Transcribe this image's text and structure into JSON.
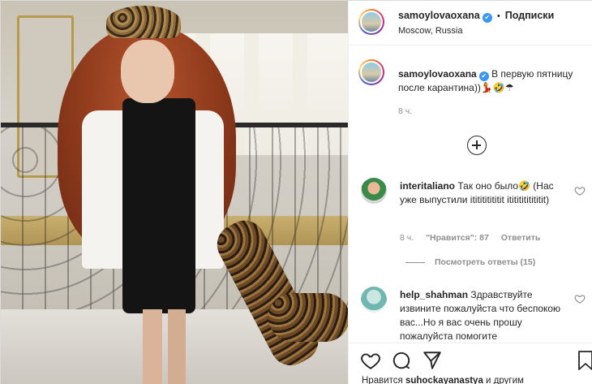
{
  "post": {
    "username": "samoylovaoxana",
    "separator": "•",
    "follow_label": "Подписки",
    "location": "Moscow, Russia",
    "caption_text": "В первую пятницу после карантина))💃🤣☂",
    "caption_time": "8 ч."
  },
  "comments": [
    {
      "username": "interitaliano",
      "text": "Так оно было🤣 (Нас уже выпустили ititititititit itititititititit)",
      "time": "8 ч.",
      "likes": "\"Нравится\": 87",
      "reply_label": "Ответить",
      "view_replies": "Посмотреть ответы (15)"
    },
    {
      "username": "help_shahman",
      "text": "Здравствуйте извините пожалуйста что беспокою вас...Но я вас очень прошу пожалуйста помогите"
    }
  ],
  "likes_line": {
    "prefix": "Нравится",
    "user": "suhockayanastya",
    "suffix": "и другим"
  },
  "icons": [
    "verified-badge-icon",
    "load-more-comments-icon",
    "heart-icon",
    "comment-icon",
    "share-icon",
    "bookmark-icon"
  ],
  "colors": {
    "link": "#262626",
    "muted": "#8e8e8e",
    "verified": "#3897f0",
    "border": "#dbdbdb"
  }
}
